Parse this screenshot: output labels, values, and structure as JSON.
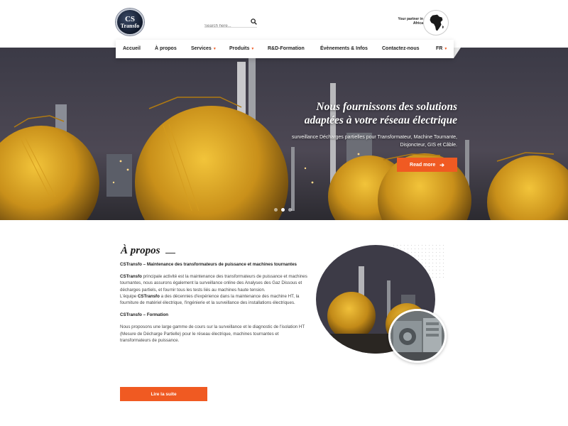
{
  "header": {
    "logo_line1": "CS",
    "logo_line2": "Transfo",
    "search_placeholder": "Search here...",
    "partner_line1": "Your partner in",
    "partner_line2": "Africa"
  },
  "nav": {
    "items": [
      {
        "label": "Accueil"
      },
      {
        "label": "À propos"
      },
      {
        "label": "Services"
      },
      {
        "label": "Produits"
      },
      {
        "label": "R&D-Formation"
      },
      {
        "label": "Évènements & Infos"
      },
      {
        "label": "Contactez-nous"
      },
      {
        "label": "FR"
      }
    ]
  },
  "hero": {
    "title_line1": "Nous fournissons des solutions",
    "title_line2": "adaptées à votre réseau électrique",
    "subtitle": "surveillance Décharges partielles pour Transformateur, Machine Tournante, Disjoncteur, GIS et Câble.",
    "button_label": "Read more",
    "accent_color": "#f05a22"
  },
  "about": {
    "title": "À propos",
    "heading1": "CSTransfo – Maintenance des transformateurs de puissance et machines tournantes",
    "p1_brand": "CSTransfo",
    "p1_rest": " principale activité est la maintenance des transformateurs de puissance et machines tournantes, nous assurons également la surveillance online des Analyses des Gaz Dissous et décharges partiels, et fournir tous les tests liés au machines haute tension.",
    "p2_start": "L'équipe ",
    "p2_brand": "CSTransfo",
    "p2_rest": " a des décennies d'expérience dans la maintenance des machine HT, la fourniture de matériel électrique, l'ingénierie et la surveillance des installations électriques.",
    "heading2": "CSTransfo – Formation",
    "p3": "Nous proposons une large gamme de cours sur la surveillance et le diagnostic de l'isolation HT (Mesure de Décharge Partielle) pour le réseau électrique, machines tournantes et transformateurs de puissance.",
    "button_label": "Lire la suite"
  }
}
